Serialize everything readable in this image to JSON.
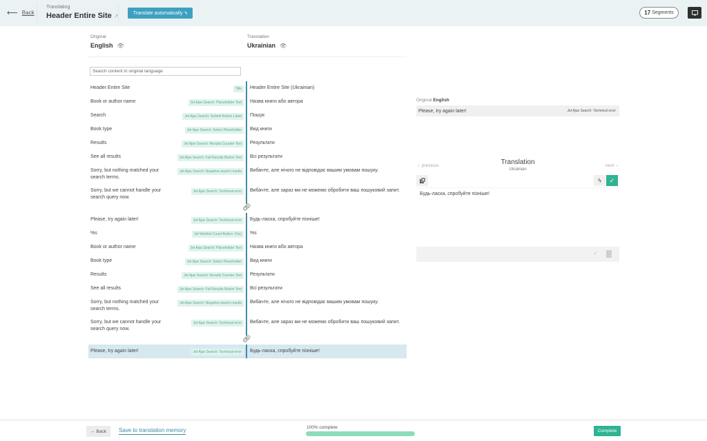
{
  "header": {
    "back_label": "Back",
    "back_icon": "arrow-left-icon",
    "subtitle": "Translating",
    "title": "Header Entire Site",
    "translate_auto_label": "Translate automatically",
    "segments_count": "17",
    "segments_label": "Segments",
    "chat_icon": "chat-icon"
  },
  "languages": {
    "original_label": "Original",
    "original_value": "English",
    "translation_label": "Translation",
    "translation_value": "Ukrainian"
  },
  "search": {
    "placeholder": "Search content in original language"
  },
  "segments": [
    {
      "original": "Header Entire Site",
      "tag": "Title",
      "translation": "Header Entire Site (Ukrainian)"
    },
    {
      "original": "Book or author name",
      "tag": "Jet Ajax Search: Placeholder Text",
      "translation": "Назва книги або автора"
    },
    {
      "original": "Search",
      "tag": "Jet Ajax Search: Submit Button Label",
      "translation": "Пошук"
    },
    {
      "original": "Book type",
      "tag": "Jet Ajax Search: Select Placeholder",
      "translation": "Вид книги"
    },
    {
      "original": "Results",
      "tag": "Jet Ajax Search: Results Counter Text",
      "translation": "Результати"
    },
    {
      "original": "See all results",
      "tag": "Jet Ajax Search: Full Results Button Text",
      "translation": "Всі результати"
    },
    {
      "original": "Sorry, but nothing matched your search terms.",
      "tag": "Jet Ajax Search: Negative search results",
      "translation": "Вибачте, але нічого не відповідає вашим умовам пошуку."
    },
    {
      "original": "Sorry, but we cannot handle your search query now.",
      "tag": "Jet Ajax Search: Technical error",
      "translation": "Вибачте, але зараз ми не можемо обробити ваш пошуковий запит."
    },
    {
      "original": "Please, try again later!",
      "tag": "Jet Ajax Search: Technical error",
      "translation": "Будь-ласка, спробуйте пізніше!"
    },
    {
      "original": "%s",
      "tag": "Jet Wishlist Count Button: (%s)",
      "translation": "%s"
    },
    {
      "original": "Book or author name",
      "tag": "Jet Ajax Search: Placeholder Text",
      "translation": "Назва книги або автора"
    },
    {
      "original": "Book type",
      "tag": "Jet Ajax Search: Select Placeholder",
      "translation": "Вид книги"
    },
    {
      "original": "Results",
      "tag": "Jet Ajax Search: Results Counter Text",
      "translation": "Результати"
    },
    {
      "original": "See all results",
      "tag": "Jet Ajax Search: Full Results Button Text",
      "translation": "Всі результати"
    },
    {
      "original": "Sorry, but nothing matched your search terms.",
      "tag": "Jet Ajax Search: Negative search results",
      "translation": "Вибачте, але нічого не відповідає вашим умовам пошуку."
    },
    {
      "original": "Sorry, but we cannot handle your search query now.",
      "tag": "Jet Ajax Search: Technical error",
      "translation": "Вибачте, але зараз ми не можемо обробити ваш пошуковий запит."
    },
    {
      "original": "Please, try again later!",
      "tag": "Jet Ajax Search: Technical error",
      "translation": "Будь-ласка, спробуйте пізніше!"
    }
  ],
  "link_after_indices": [
    7,
    15
  ],
  "active_index": 16,
  "editor": {
    "original_label": "Original",
    "original_lang": "English",
    "original_text": "Please, try again later!",
    "original_context": "Jet Ajax Search: Technical error",
    "previous_label": "previous",
    "next_label": "next",
    "translation_title": "Translation",
    "translation_lang": "Ukrainian",
    "translation_text": "Будь-ласка, спробуйте пізніше!"
  },
  "footer": {
    "back_label": "← Back",
    "save_label": "Save to translation memory",
    "progress_label": "100% complete",
    "progress_percent": 100,
    "complete_label": "Complete"
  },
  "colors": {
    "accent": "#3d8ba3",
    "auto_button": "#3ea0c0",
    "success": "#2fb394",
    "progress": "#8edcbc",
    "tag_bg": "#dff3ec",
    "active_row": "#d6e8f0",
    "header_bg": "#eaf2f4"
  }
}
